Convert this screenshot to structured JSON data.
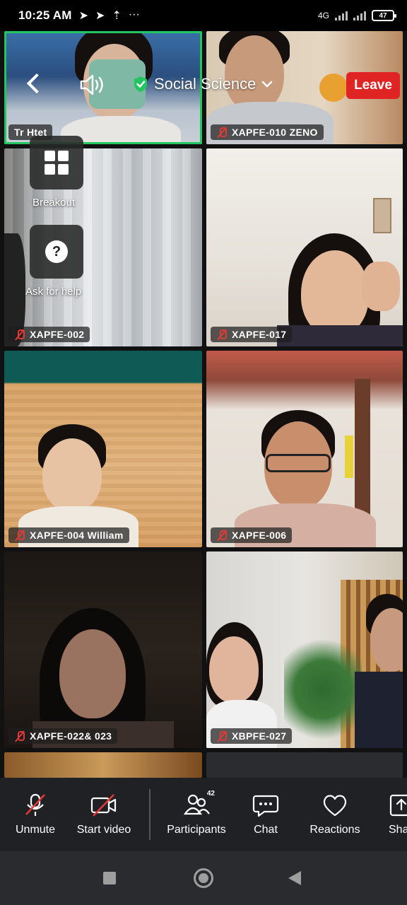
{
  "status_bar": {
    "time": "10:25 AM",
    "network": "4G",
    "battery": "47"
  },
  "meeting": {
    "title": "Social Science",
    "leave_label": "Leave"
  },
  "participants": [
    {
      "name": "Tr Htet",
      "muted": false,
      "active_speaker": true
    },
    {
      "name": "XAPFE-010 ZENO",
      "muted": true
    },
    {
      "name": "XAPFE-002",
      "muted": true
    },
    {
      "name": "XAPFE-017",
      "muted": true
    },
    {
      "name": "XAPFE-004 William",
      "muted": true
    },
    {
      "name": "XAPFE-006",
      "muted": true
    },
    {
      "name": "XAPFE-022& 023",
      "muted": true
    },
    {
      "name": "XBPFE-027",
      "muted": true
    }
  ],
  "side_buttons": {
    "breakout_label": "Breakout",
    "help_label": "Ask for help"
  },
  "toolbar": {
    "unmute_label": "Unmute",
    "start_video_label": "Start video",
    "participants_label": "Participants",
    "participants_count": "42",
    "chat_label": "Chat",
    "reactions_label": "Reactions",
    "share_label": "Sha"
  },
  "colors": {
    "leave": "#e02424",
    "active_speaker_border": "#22c55e",
    "muted_icon": "#e53935",
    "toolbar_bg": "#1f2124"
  },
  "icons": [
    "back-icon",
    "speaker-icon",
    "shield-check-icon",
    "chevron-down-icon",
    "grid-icon",
    "question-icon",
    "mic-off-icon",
    "video-off-icon",
    "participants-icon",
    "chat-icon",
    "heart-icon",
    "share-icon"
  ]
}
